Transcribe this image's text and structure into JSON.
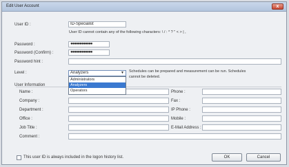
{
  "window": {
    "title": "Edit User Account",
    "close_label": "x"
  },
  "account": {
    "user_id_label": "User ID :",
    "user_id_value": "ID-Specialist",
    "user_id_note": "User ID cannot contain any of the following characters: \\ / : * ? \" < > | ,",
    "password_label": "Password :",
    "password_value": "●●●●●●●●●●●●",
    "password_confirm_label": "Password (Confirm) :",
    "password_confirm_value": "●●●●●●●●●●●●",
    "password_hint_label": "Password hint :",
    "password_hint_value": "",
    "level_label": "Level :",
    "level_selected": "Analyzers",
    "level_note_line1": "Schedules can be prepared and measurement can be run. Schedules",
    "level_note_line2": "cannot be deleted.",
    "level_options": [
      "Administrators",
      "Analyzers",
      "Operators"
    ]
  },
  "user_info": {
    "section_label": "User Information",
    "name_label": "Name :",
    "company_label": "Company :",
    "department_label": "Department :",
    "office_label": "Office :",
    "job_title_label": "Job Title :",
    "comment_label": "Comment :",
    "phone_label": "Phone :",
    "fax_label": "Fax :",
    "ip_phone_label": "IP Phone :",
    "mobile_label": "Mobile :",
    "email_label": "E-Mail Address :"
  },
  "footer": {
    "logon_history_label": "This user ID is always included in the logon history list.",
    "ok_label": "OK",
    "cancel_label": "Cancel"
  }
}
